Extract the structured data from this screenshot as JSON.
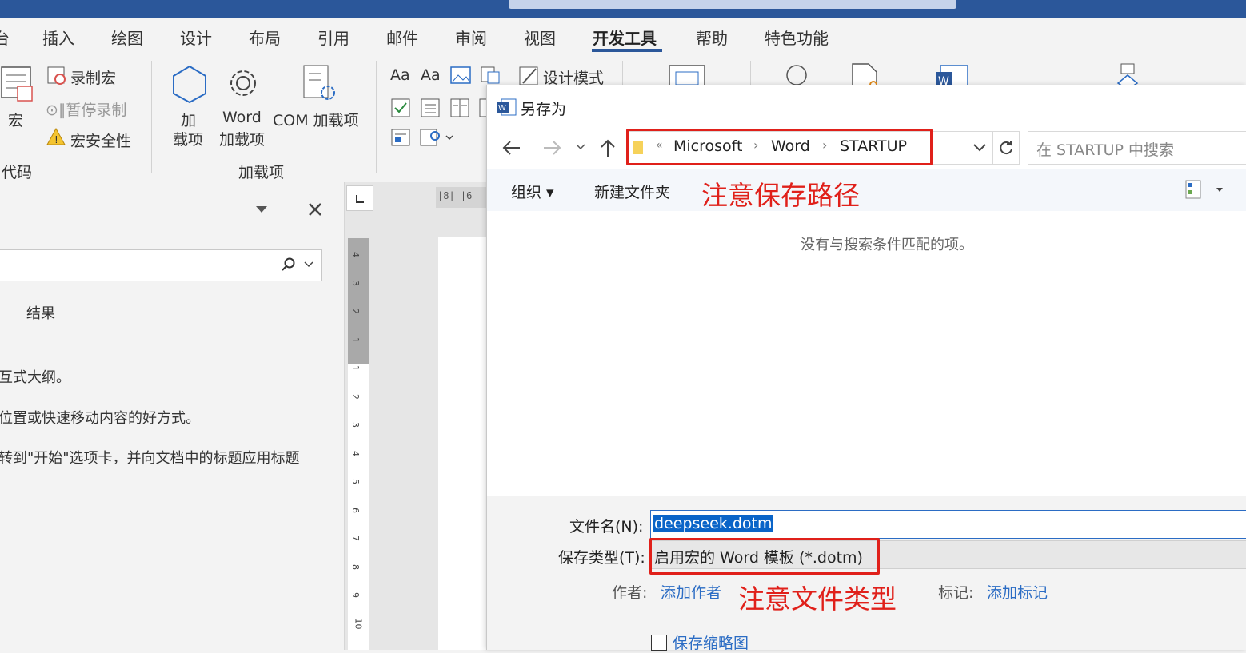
{
  "ribbon_tabs": [
    "台",
    "插入",
    "绘图",
    "设计",
    "布局",
    "引用",
    "邮件",
    "审阅",
    "视图",
    "开发工具",
    "帮助",
    "特色功能"
  ],
  "ribbon": {
    "code_group": {
      "macro": "宏",
      "record_macro": "录制宏",
      "pause_recording": "⊙∥暂停录制",
      "macro_security": "宏安全性",
      "label": "代码"
    },
    "addins_group": {
      "addin_line1": "加",
      "addin_line2": "载项",
      "word_addin_line1": "Word",
      "word_addin_line2": "加载项",
      "com_addin": "COM 加载项",
      "label": "加载项"
    },
    "controls_group": {
      "aa1": "Aa",
      "aa2": "Aa",
      "design_mode": "设计模式"
    }
  },
  "nav_pane": {
    "results_tab": "结果",
    "lines": [
      "互式大纲。",
      "位置或快速移动内容的好方式。",
      "转到\"开始\"选项卡，并向文档中的标题应用标题"
    ]
  },
  "hruler_text": "|8|  |6",
  "vruler_numbers": [
    "4",
    "3",
    "2",
    "1",
    "1",
    "2",
    "3",
    "4",
    "5",
    "6",
    "7",
    "8",
    "9",
    "10"
  ],
  "dialog": {
    "title": "另存为",
    "breadcrumb": [
      "«",
      "Microsoft",
      "Word",
      "STARTUP"
    ],
    "search_placeholder": "在 STARTUP 中搜索",
    "organize": "组织 ▾",
    "new_folder": "新建文件夹",
    "annotation_path": "注意保存路径",
    "empty_message": "没有与搜索条件匹配的项。",
    "filename_label": "文件名(N):",
    "filename_value": "deepseek.dotm",
    "filetype_label": "保存类型(T):",
    "filetype_value": "启用宏的 Word 模板 (*.dotm)",
    "author_label": "作者:",
    "author_value": "添加作者",
    "annotation_type": "注意文件类型",
    "tags_label": "标记:",
    "tags_value": "添加标记",
    "thumbnail_label": "保存缩略图"
  }
}
